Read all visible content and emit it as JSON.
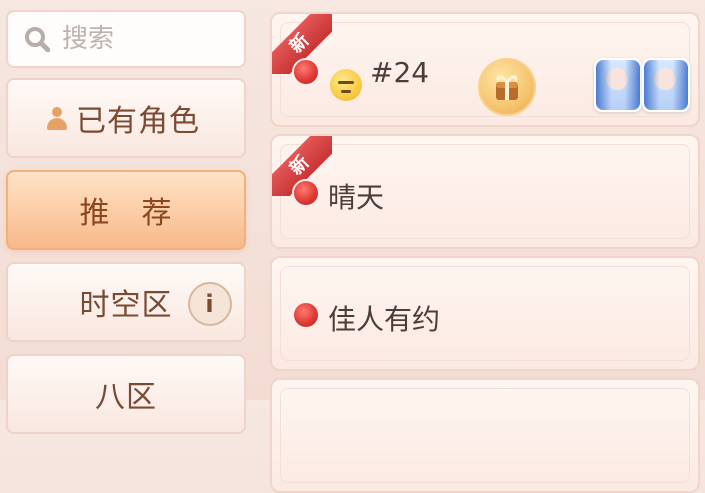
{
  "search": {
    "placeholder": "搜索"
  },
  "sidebar": {
    "tabs": [
      {
        "label": "已有角色",
        "active": false,
        "icon": "person-icon"
      },
      {
        "label": "推　荐",
        "active": true
      },
      {
        "label": "时空区",
        "active": false,
        "info_icon": "i"
      },
      {
        "label": "八区",
        "active": false
      }
    ]
  },
  "servers": [
    {
      "badge": "新",
      "status_color": "#e03a35",
      "emoji": "neutral-face",
      "name": "#24",
      "gift": true,
      "avatars": 2
    },
    {
      "badge": "新",
      "status_color": "#e03a35",
      "name": "晴天"
    },
    {
      "status_color": "#e03a35",
      "name": "佳人有约"
    },
    {
      "name": ""
    }
  ],
  "colors": {
    "accent_active": "#f7b98a",
    "status_red": "#e03a35",
    "ribbon": "#c83434"
  }
}
